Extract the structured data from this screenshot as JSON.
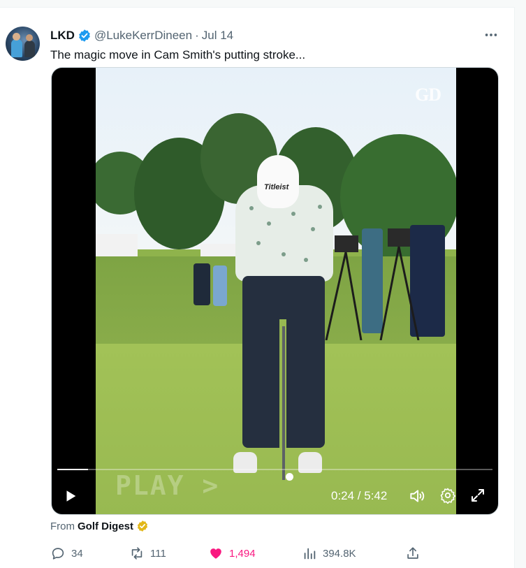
{
  "tweet": {
    "author_name": "LKD",
    "handle": "@LukeKerrDineen",
    "separator": "·",
    "date": "Jul 14",
    "text": "The magic move in Cam Smith's putting stroke...",
    "source_prefix": "From",
    "source_name": "Golf Digest"
  },
  "video": {
    "watermark": "GD",
    "overlay_text": "PLAY >",
    "cap_text": "Titleist",
    "time_display": "0:24 / 5:42",
    "progress_fraction": 0.07
  },
  "actions": {
    "replies": "34",
    "retweets": "111",
    "likes": "1,494",
    "views": "394.8K"
  },
  "colors": {
    "verified_blue": "#1d9bf0",
    "gold_badge": "#e2b719",
    "like_pink": "#f91880",
    "secondary_text": "#536471"
  },
  "icons": [
    "verified-icon",
    "more-icon",
    "play-icon",
    "volume-icon",
    "settings-icon",
    "fullscreen-icon",
    "gold-badge-icon",
    "reply-icon",
    "retweet-icon",
    "heart-icon",
    "views-icon",
    "share-icon"
  ]
}
